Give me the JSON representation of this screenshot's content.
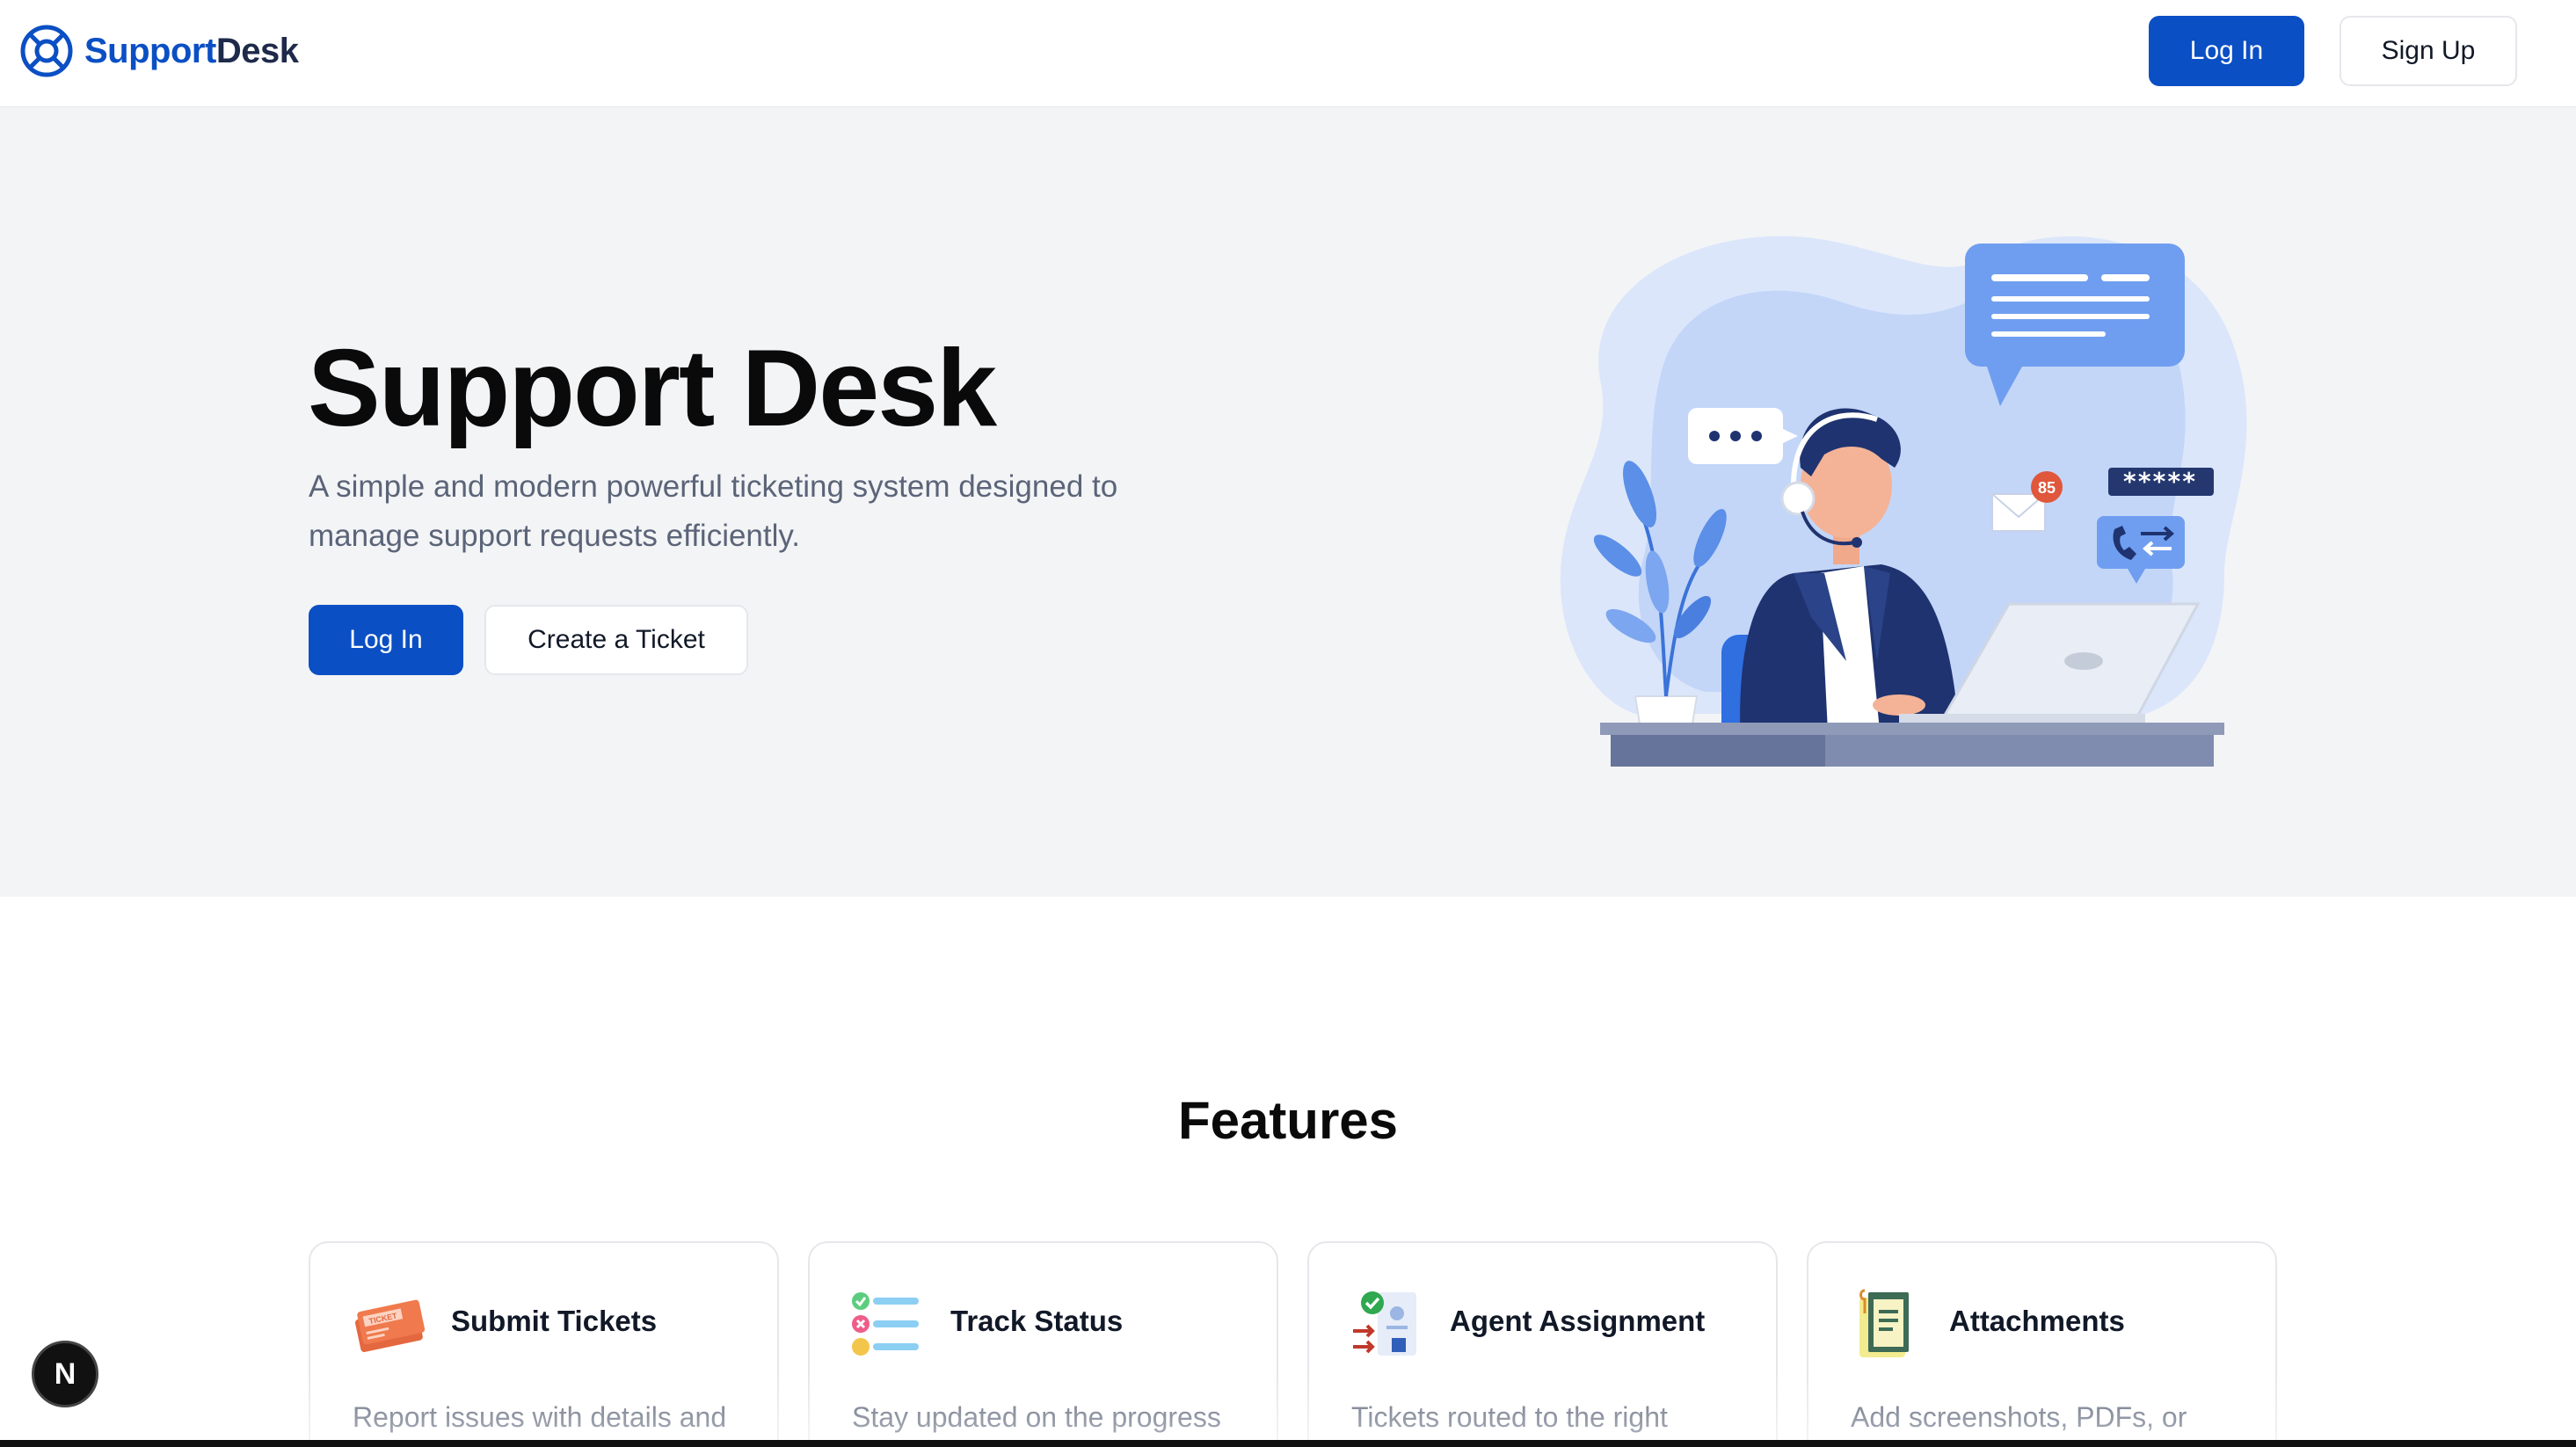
{
  "header": {
    "brand_part1": "Support",
    "brand_part2": "Desk",
    "login_label": "Log In",
    "signup_label": "Sign Up"
  },
  "hero": {
    "title": "Support Desk",
    "subtitle": "A simple and modern powerful ticketing system designed to manage support requests efficiently.",
    "login_label": "Log In",
    "create_ticket_label": "Create a Ticket",
    "illustration": {
      "notification_count": "85",
      "password_mask": "*****"
    }
  },
  "features": {
    "title": "Features",
    "cards": [
      {
        "title": "Submit Tickets",
        "description": "Report issues with details and",
        "icon": "ticket-icon",
        "icon_text": "TICKET"
      },
      {
        "title": "Track Status",
        "description": "Stay updated on the progress",
        "icon": "status-list-icon"
      },
      {
        "title": "Agent Assignment",
        "description": "Tickets routed to the right",
        "icon": "agent-assignment-icon"
      },
      {
        "title": "Attachments",
        "description": "Add screenshots, PDFs, or",
        "icon": "attachment-clipboard-icon"
      }
    ]
  },
  "dev_badge": "N",
  "colors": {
    "primary": "#0b4fc4",
    "hero_bg": "#f3f4f6",
    "text_muted": "#5b6478"
  }
}
